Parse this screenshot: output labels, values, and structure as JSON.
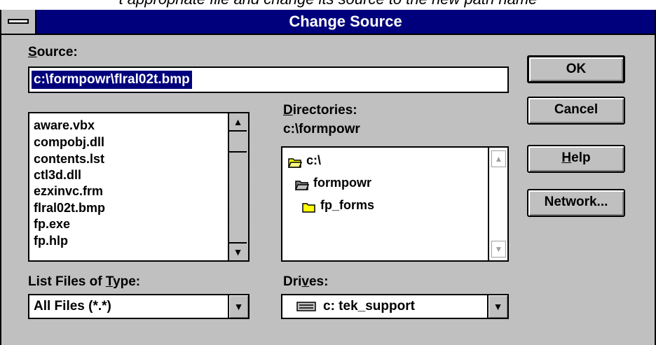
{
  "background_caption": "t appropriate file and change its source to the new path name",
  "window": {
    "title": "Change Source"
  },
  "source": {
    "label_underline": "S",
    "label_rest": "ource:",
    "value": "c:\\formpowr\\flral02t.bmp"
  },
  "files": {
    "items": [
      "aware.vbx",
      "compobj.dll",
      "contents.lst",
      "ctl3d.dll",
      "ezxinvc.frm",
      "flral02t.bmp",
      "fp.exe",
      "fp.hlp"
    ]
  },
  "directories": {
    "label_underline": "D",
    "label_rest": "irectories:",
    "current_path": "c:\\formpowr",
    "items": [
      "c:\\",
      "formpowr",
      "fp_forms"
    ]
  },
  "file_type": {
    "label_pre": "List Files of ",
    "label_underline": "T",
    "label_post": "ype:",
    "value": "All Files (*.*)"
  },
  "drives": {
    "label_pre": "Dri",
    "label_underline": "v",
    "label_post": "es:",
    "value": "c: tek_support"
  },
  "buttons": {
    "ok": "OK",
    "cancel": "Cancel",
    "help_underline": "H",
    "help_rest": "elp",
    "network": "Network..."
  },
  "icons": {
    "scroll_up": "▲",
    "scroll_down": "▼",
    "dropdown": "▼"
  }
}
